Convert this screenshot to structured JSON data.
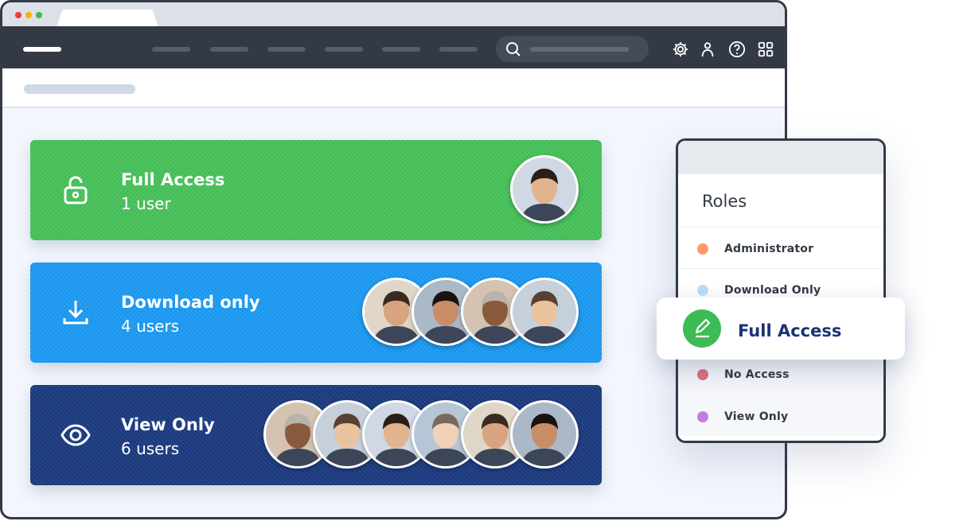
{
  "colors": {
    "full_access": "#47c35a",
    "download_only": "#1b9bf5",
    "view_only": "#1b3a80",
    "nav": "#333a45"
  },
  "access_groups": [
    {
      "title": "Full Access",
      "count": "1 user",
      "icon": "unlock-icon",
      "avatars": 1
    },
    {
      "title": "Download only",
      "count": "4 users",
      "icon": "download-icon",
      "avatars": 4
    },
    {
      "title": "View Only",
      "count": "6 users",
      "icon": "eye-icon",
      "avatars": 6
    }
  ],
  "roles_panel": {
    "title": "Roles",
    "items": [
      {
        "label": "Administrator",
        "color": "#fd9a6a"
      },
      {
        "label": "Download Only",
        "color": "#b9dffc"
      },
      {
        "label": "No Access",
        "color": "#d9727c"
      },
      {
        "label": "View Only",
        "color": "#c17fdc"
      }
    ],
    "selected": {
      "label": "Full Access",
      "icon": "edit-icon"
    }
  }
}
